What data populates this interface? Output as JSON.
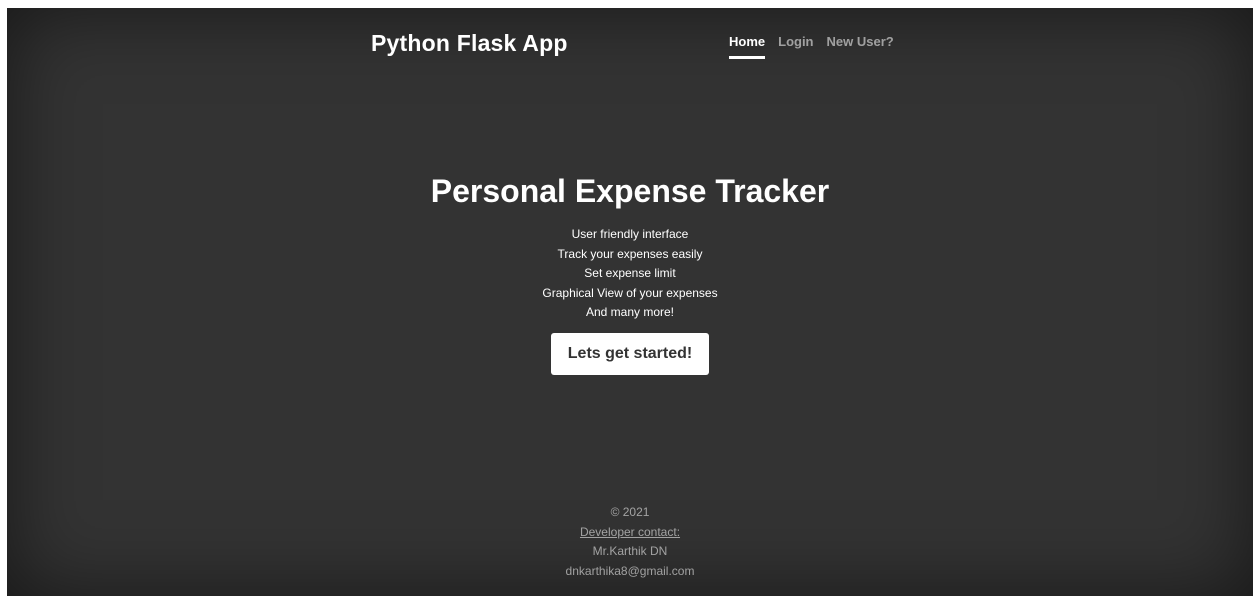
{
  "header": {
    "brand": "Python Flask App",
    "nav": [
      {
        "label": "Home",
        "active": true
      },
      {
        "label": "Login",
        "active": false
      },
      {
        "label": "New User?",
        "active": false
      }
    ]
  },
  "hero": {
    "title": "Personal Expense Tracker",
    "features": [
      "User friendly interface",
      "Track your expenses easily",
      "Set expense limit",
      "Graphical View of your expenses",
      "And many more!"
    ],
    "cta_label": "Lets get started!"
  },
  "footer": {
    "copyright": "© 2021",
    "contact_link": "Developer contact:",
    "developer_name": "Mr.Karthik DN",
    "email": "dnkarthika8@gmail.com"
  },
  "colors": {
    "background": "#333333",
    "text": "#ffffff",
    "muted": "rgba(255,255,255,0.55)",
    "button_bg": "#ffffff",
    "button_text": "#333333"
  }
}
